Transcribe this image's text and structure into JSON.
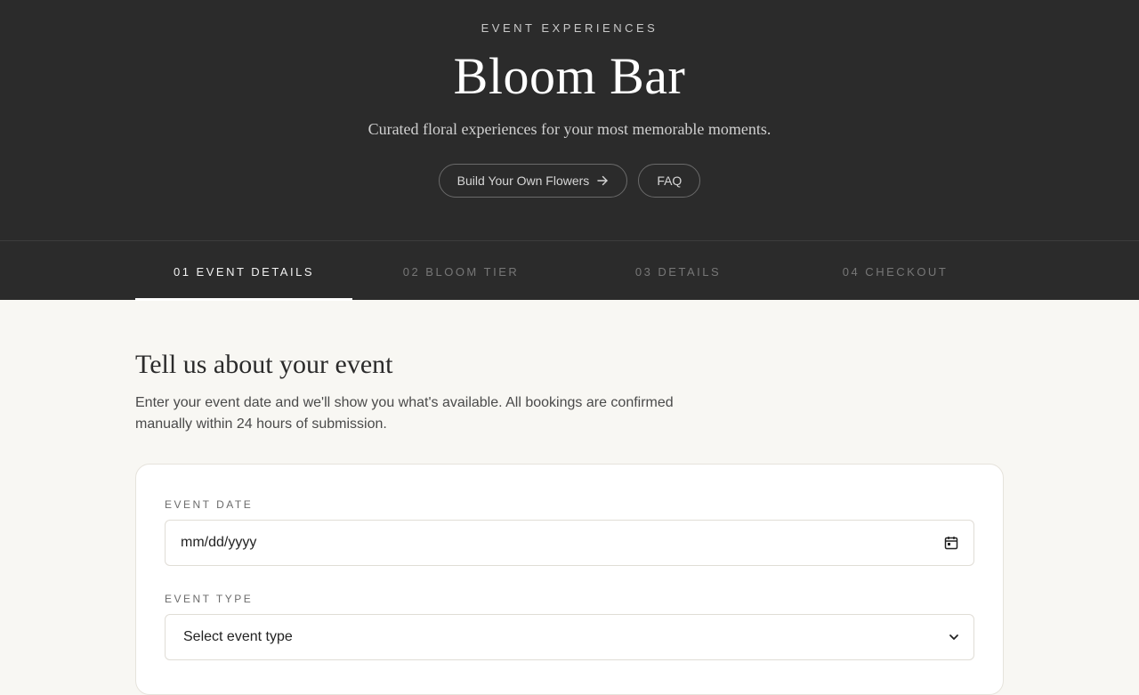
{
  "hero": {
    "eyebrow": "EVENT EXPERIENCES",
    "title": "Bloom Bar",
    "tagline": "Curated floral experiences for your most memorable moments.",
    "build_button": "Build Your Own Flowers",
    "faq_button": "FAQ"
  },
  "steps": [
    {
      "label": "01 EVENT DETAILS",
      "active": true
    },
    {
      "label": "02 BLOOM TIER",
      "active": false
    },
    {
      "label": "03 DETAILS",
      "active": false
    },
    {
      "label": "04 CHECKOUT",
      "active": false
    }
  ],
  "section": {
    "title": "Tell us about your event",
    "description": "Enter your event date and we'll show you what's available. All bookings are confirmed manually within 24 hours of submission."
  },
  "form": {
    "event_date_label": "EVENT DATE",
    "event_date_placeholder": "mm/dd/yyyy",
    "event_type_label": "EVENT TYPE",
    "event_type_value": "Select event type"
  },
  "icons": {
    "arrow": "arrow-right-icon",
    "calendar": "calendar-icon",
    "chevron": "chevron-down-icon"
  }
}
